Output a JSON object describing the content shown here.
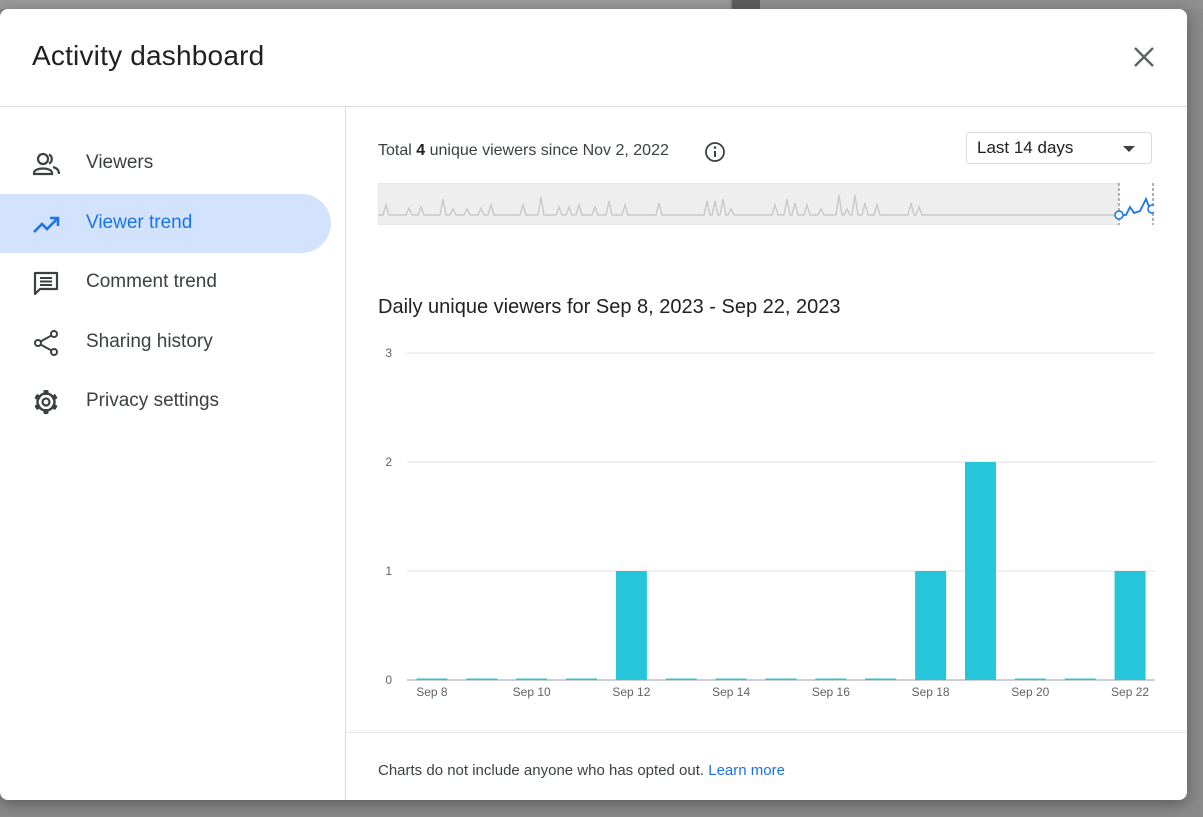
{
  "dialog": {
    "title": "Activity dashboard"
  },
  "sidebar": {
    "items": [
      {
        "label": "Viewers",
        "icon": "people-icon",
        "active": false
      },
      {
        "label": "Viewer trend",
        "icon": "trending-up-icon",
        "active": true
      },
      {
        "label": "Comment trend",
        "icon": "comment-icon",
        "active": false
      },
      {
        "label": "Sharing history",
        "icon": "share-icon",
        "active": false
      },
      {
        "label": "Privacy settings",
        "icon": "gear-icon",
        "active": false
      }
    ]
  },
  "summary": {
    "prefix": "Total",
    "count": "4",
    "suffix": "unique viewers since Nov 2, 2022"
  },
  "range_select": {
    "selected": "Last 14 days"
  },
  "chart_data": {
    "type": "bar",
    "title": "Daily unique viewers for Sep 8, 2023 - Sep 22, 2023",
    "categories": [
      "Sep 8",
      "Sep 9",
      "Sep 10",
      "Sep 11",
      "Sep 12",
      "Sep 13",
      "Sep 14",
      "Sep 15",
      "Sep 16",
      "Sep 17",
      "Sep 18",
      "Sep 19",
      "Sep 20",
      "Sep 21",
      "Sep 22"
    ],
    "tick_labels": [
      "Sep 8",
      "Sep 10",
      "Sep 12",
      "Sep 14",
      "Sep 16",
      "Sep 18",
      "Sep 20",
      "Sep 22"
    ],
    "values": [
      0,
      0,
      0,
      0,
      1,
      0,
      0,
      0,
      0,
      0,
      1,
      2,
      0,
      0,
      1
    ],
    "ylim": [
      0,
      3
    ],
    "yticks": [
      0,
      1,
      2,
      3
    ],
    "grid": true,
    "bar_color": "#26c6da"
  },
  "footer": {
    "text": "Charts do not include anyone who has opted out.",
    "link": "Learn more"
  },
  "colors": {
    "accent": "#1a73e8",
    "active_nav_bg": "#d3e3fd",
    "bar": "#26c6da"
  }
}
